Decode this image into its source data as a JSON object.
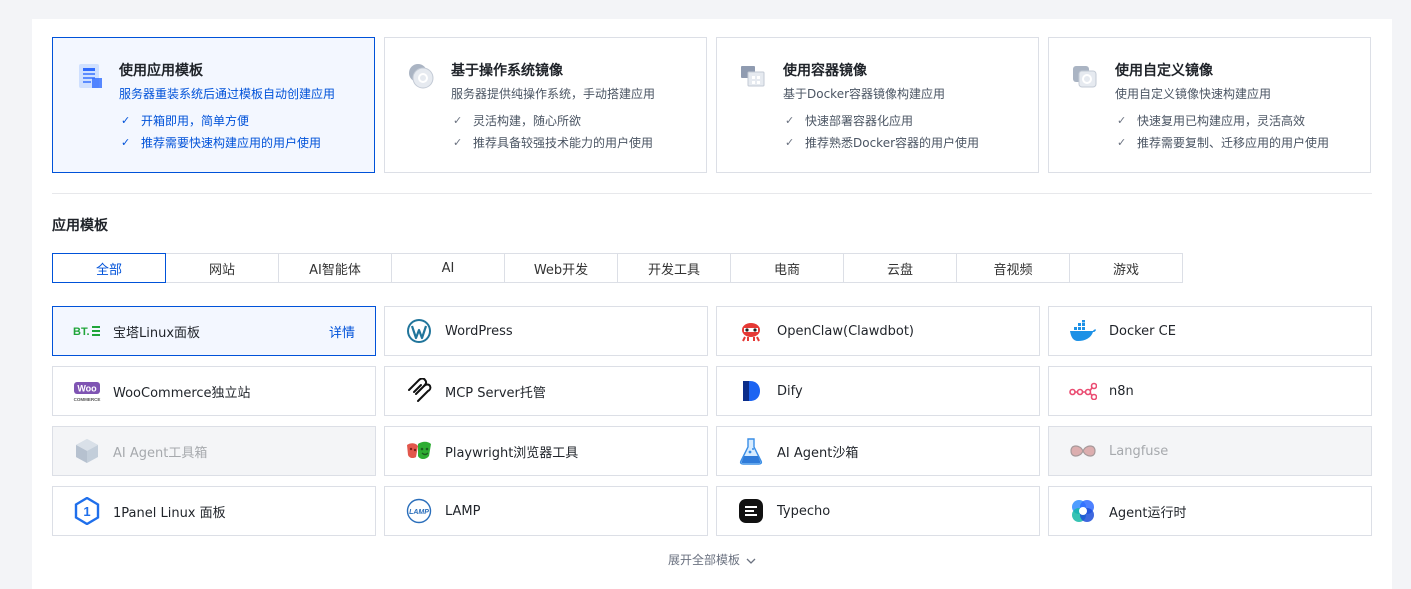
{
  "sources": [
    {
      "title": "使用应用模板",
      "desc": "服务器重装系统后通过模板自动创建应用",
      "items": [
        "开箱即用，简单方便",
        "推荐需要快速构建应用的用户使用"
      ],
      "icon": "app-template-icon"
    },
    {
      "title": "基于操作系统镜像",
      "desc": "服务器提供纯操作系统，手动搭建应用",
      "items": [
        "灵活构建，随心所欲",
        "推荐具备较强技术能力的用户使用"
      ],
      "icon": "os-image-icon"
    },
    {
      "title": "使用容器镜像",
      "desc": "基于Docker容器镜像构建应用",
      "items": [
        "快速部署容器化应用",
        "推荐熟悉Docker容器的用户使用"
      ],
      "icon": "container-image-icon"
    },
    {
      "title": "使用自定义镜像",
      "desc": "使用自定义镜像快速构建应用",
      "items": [
        "快速复用已构建应用，灵活高效",
        "推荐需要复制、迁移应用的用户使用"
      ],
      "icon": "custom-image-icon"
    }
  ],
  "section_title": "应用模板",
  "tabs": [
    "全部",
    "网站",
    "AI智能体",
    "AI",
    "Web开发",
    "开发工具",
    "电商",
    "云盘",
    "音视频",
    "游戏"
  ],
  "templates": [
    {
      "name": "宝塔Linux面板",
      "detail": "详情",
      "icon": "bt-panel-icon"
    },
    {
      "name": "WordPress",
      "icon": "wordpress-icon"
    },
    {
      "name": "OpenClaw(Clawdbot)",
      "icon": "openclaw-icon"
    },
    {
      "name": "Docker CE",
      "icon": "docker-icon"
    },
    {
      "name": "WooCommerce独立站",
      "icon": "woocommerce-icon",
      "logo_text": "Woo",
      "logo_sub": "COMMERCE"
    },
    {
      "name": "MCP Server托管",
      "icon": "mcp-icon"
    },
    {
      "name": "Dify",
      "icon": "dify-icon"
    },
    {
      "name": "n8n",
      "icon": "n8n-icon"
    },
    {
      "name": "AI Agent工具箱",
      "icon": "ai-agent-toolbox-icon"
    },
    {
      "name": "Playwright浏览器工具",
      "icon": "playwright-icon"
    },
    {
      "name": "AI Agent沙箱",
      "icon": "ai-agent-sandbox-icon"
    },
    {
      "name": "Langfuse",
      "icon": "langfuse-icon"
    },
    {
      "name": "1Panel Linux 面板",
      "icon": "1panel-icon",
      "logo_text": "1"
    },
    {
      "name": "LAMP",
      "icon": "lamp-icon",
      "logo_text": "LAMP"
    },
    {
      "name": "Typecho",
      "icon": "typecho-icon"
    },
    {
      "name": "Agent运行时",
      "icon": "agent-runtime-icon"
    }
  ],
  "bt_logo": "BT.",
  "expand_label": "展开全部模板",
  "colors": {
    "accent": "#0052d9",
    "border": "#dcdfe6",
    "active_bg": "#f3f7ff"
  }
}
